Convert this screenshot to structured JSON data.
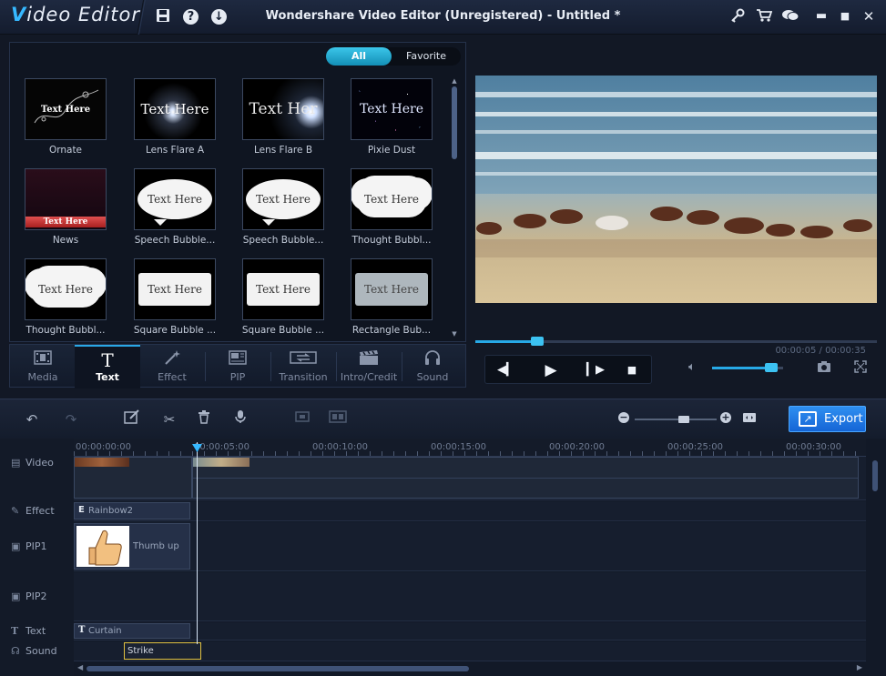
{
  "app": {
    "logo_prefix": "V",
    "logo_rest": "ideo Editor",
    "window_title": "Wondershare Video Editor (Unregistered) - Untitled *"
  },
  "library": {
    "filters": {
      "all": "All",
      "favorite": "Favorite",
      "active": "All"
    },
    "items": [
      {
        "name": "Ornate",
        "preview_text": "Text Here",
        "style": "ornate"
      },
      {
        "name": "Lens Flare A",
        "preview_text": "Text Here",
        "style": "lensflare-a"
      },
      {
        "name": "Lens Flare B",
        "preview_text": "Text Her",
        "style": "lensflare-b"
      },
      {
        "name": "Pixie Dust",
        "preview_text": "Text Here",
        "style": "pixie"
      },
      {
        "name": "News",
        "preview_text": "Text Here",
        "style": "news"
      },
      {
        "name": "Speech Bubble...",
        "preview_text": "Text Here",
        "style": "bubble"
      },
      {
        "name": "Speech Bubble...",
        "preview_text": "Text Here",
        "style": "bubble"
      },
      {
        "name": "Thought Bubbl...",
        "preview_text": "Text Here",
        "style": "cloud"
      },
      {
        "name": "Thought Bubbl...",
        "preview_text": "Text Here",
        "style": "cloud"
      },
      {
        "name": "Square Bubble ...",
        "preview_text": "Text Here",
        "style": "square"
      },
      {
        "name": "Square Bubble ...",
        "preview_text": "Text Here",
        "style": "square"
      },
      {
        "name": "Rectangle Bub...",
        "preview_text": "Text Here",
        "style": "rect-grey"
      }
    ]
  },
  "tabs": [
    {
      "label": "Media",
      "icon": "film-icon",
      "active": false
    },
    {
      "label": "Text",
      "icon": "text-t-icon",
      "active": true
    },
    {
      "label": "Effect",
      "icon": "magic-wand-icon",
      "active": false
    },
    {
      "label": "PIP",
      "icon": "pip-icon",
      "active": false
    },
    {
      "label": "Transition",
      "icon": "transition-icon",
      "active": false
    },
    {
      "label": "Intro/Credit",
      "icon": "clapper-icon",
      "active": false
    },
    {
      "label": "Sound",
      "icon": "headphones-icon",
      "active": false
    }
  ],
  "player": {
    "timecode": "00:00:05 / 00:00:35",
    "progress_fraction": 0.14,
    "volume_fraction": 0.83
  },
  "toolbar": {
    "export_label": "Export",
    "zoom_fraction": 0.6
  },
  "timeline": {
    "ruler": [
      "00:00:00:00",
      "00:00:05:00",
      "00:00:10:00",
      "00:00:15:00",
      "00:00:20:00",
      "00:00:25:00",
      "00:00:30:00"
    ],
    "tracks": {
      "video": "Video",
      "effect": "Effect",
      "pip1": "PIP1",
      "pip2": "PIP2",
      "text": "Text",
      "sound": "Sound"
    },
    "clips": {
      "effect": "Rainbow2",
      "effect_badge": "E",
      "pip": "Thumb up",
      "text": "Curtain",
      "text_badge": "T",
      "sound": "Strike"
    }
  },
  "colors": {
    "accent": "#27a9e6",
    "export": "#1e78e6",
    "bg": "#121825"
  }
}
